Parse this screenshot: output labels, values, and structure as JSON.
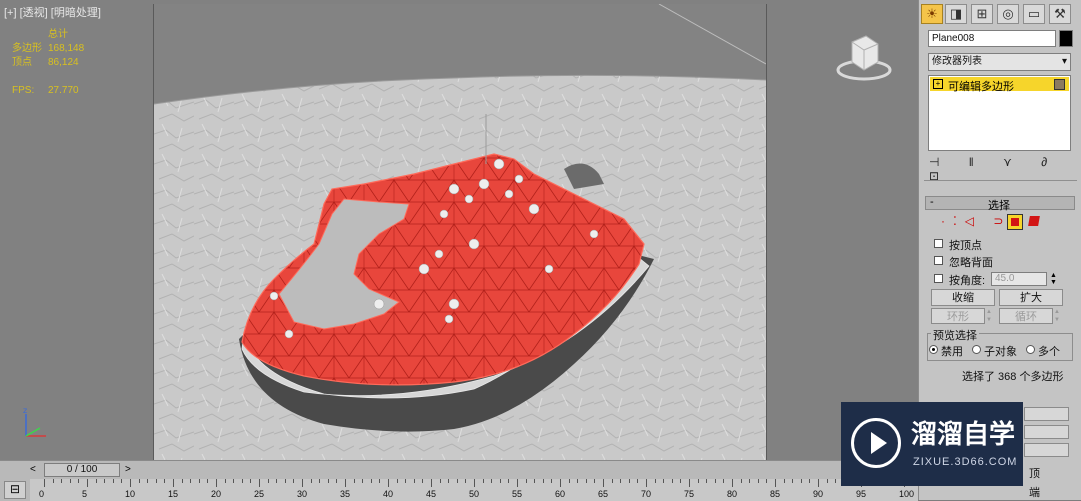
{
  "viewport": {
    "label_parts": [
      "[+]",
      "[透视]",
      "[明暗处理]"
    ],
    "stats_header": "总计",
    "stats": [
      {
        "label": "多边形",
        "value": "168,148"
      },
      {
        "label": "顶点",
        "value": "86,124"
      }
    ],
    "fps_label": "FPS:",
    "fps_value": "27.770"
  },
  "panel": {
    "tabs": [
      "create-icon",
      "modify-icon",
      "hierarchy-icon",
      "motion-icon",
      "display-icon",
      "utilities-icon"
    ],
    "object_name": "Plane008",
    "modifier_list_label": "修改器列表",
    "stack_item": "可编辑多边形",
    "rollout_title": "选择",
    "options": {
      "by_vertex": "按顶点",
      "ignore_backfacing": "忽略背面",
      "by_angle": "按角度:",
      "angle_value": "45.0"
    },
    "buttons": {
      "shrink": "收缩",
      "grow": "扩大",
      "ring": "环形",
      "loop": "循环"
    },
    "preview_title": "预览选择",
    "preview_options": [
      "禁用",
      "子对象",
      "多个"
    ],
    "selection_status": "选择了 368 个多边形",
    "extra_buttons": [
      "顶",
      "端"
    ]
  },
  "timeline": {
    "slider_label": "0 / 100",
    "ticks": [
      "0",
      "5",
      "10",
      "15",
      "20",
      "25",
      "30",
      "35",
      "40",
      "45",
      "50",
      "55",
      "60",
      "65",
      "70",
      "75",
      "80",
      "85",
      "90",
      "95",
      "100"
    ]
  },
  "watermark": {
    "title": "溜溜自学",
    "url": "ZIXUE.3D66.COM"
  },
  "colors": {
    "selection_red": "#e8463c",
    "panel_bg": "#c4c4c4",
    "stats_yellow": "#d8c020",
    "active_tab": "#f4c44a"
  }
}
